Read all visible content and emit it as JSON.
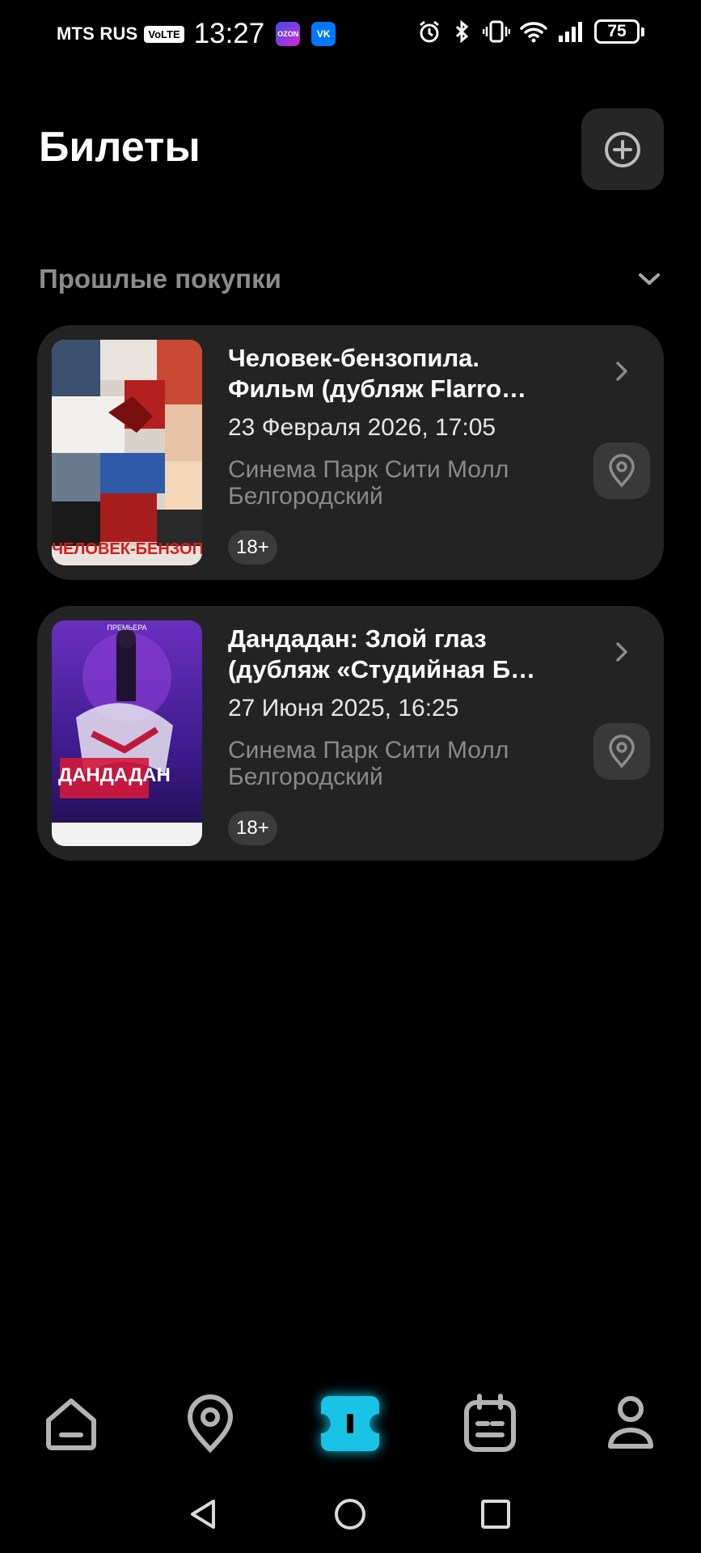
{
  "status_bar": {
    "carrier": "MTS RUS",
    "volte": "VoLTE",
    "time": "13:27",
    "apps": [
      "OZON",
      "VK"
    ],
    "battery": "75"
  },
  "header": {
    "title": "Билеты",
    "add_icon": "plus-circle-icon"
  },
  "section": {
    "title": "Прошлые покупки",
    "toggle_icon": "chevron-down-icon"
  },
  "tickets": [
    {
      "title_line1": "Человек-бензопила.",
      "title_line2": "Фильм (дубляж Flarro…",
      "date": "23 Февраля 2026, 17:05",
      "place_line1": "Синема Парк Сити Молл",
      "place_line2": "Белгородский",
      "age": "18+",
      "poster_text": "ЧЕЛОВЕК-БЕНЗОПИЛА"
    },
    {
      "title_line1": "Дандадан: Злой глаз",
      "title_line2": "(дубляж «Студийная Б…",
      "date": "27 Июня 2025, 16:25",
      "place_line1": "Синема Парк Сити Молл",
      "place_line2": "Белгородский",
      "age": "18+",
      "poster_text": "ДАНДАДАН"
    }
  ],
  "nav": {
    "items": [
      "home-icon",
      "location-icon",
      "ticket-icon",
      "calendar-icon",
      "profile-icon"
    ],
    "active": "ticket-icon",
    "active_color": "#19c3e6"
  },
  "system_nav": [
    "back-icon",
    "home-circle-icon",
    "recents-icon"
  ]
}
